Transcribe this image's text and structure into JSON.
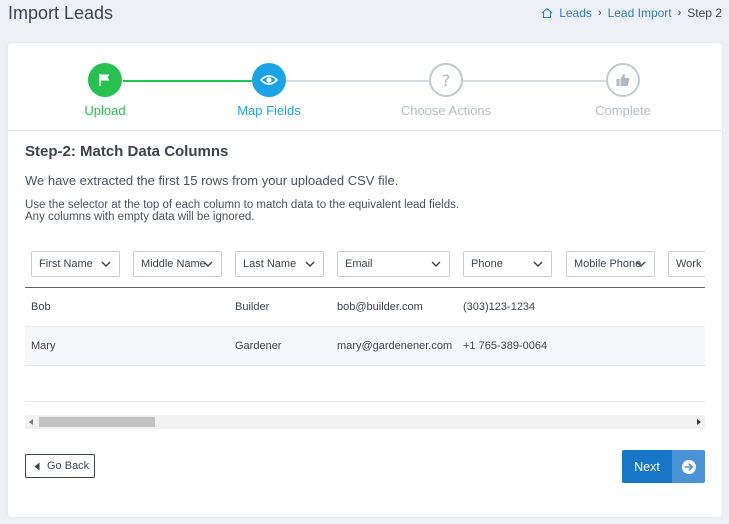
{
  "header": {
    "title": "Import Leads",
    "breadcrumb": {
      "home": "Leads",
      "parent": "Lead Import",
      "current": "Step 2"
    }
  },
  "steps": [
    {
      "label": "Upload",
      "icon": "flag-icon",
      "state": "done",
      "color": "#27c152"
    },
    {
      "label": "Map Fields",
      "icon": "eye-icon",
      "state": "active",
      "color": "#1aa3e6"
    },
    {
      "label": "Choose Actions",
      "icon": "question-icon",
      "state": "pending",
      "color": "#c3c7cf"
    },
    {
      "label": "Complete",
      "icon": "thumbs-up-icon",
      "state": "pending",
      "color": "#c3c7cf"
    }
  ],
  "content": {
    "heading": "Step-2: Match Data Columns",
    "intro": "We have extracted the first 15 rows from your uploaded CSV file.",
    "help_line1": "Use the selector at the top of each column to match data to the equivalent lead fields.",
    "help_line2": "Any columns with empty data will be ignored."
  },
  "columns": [
    "First Name",
    "Middle Name",
    "Last Name",
    "Email",
    "Phone",
    "Mobile Phone",
    "Work Phone"
  ],
  "rows": [
    {
      "first": "Bob",
      "middle": "",
      "last": "Builder",
      "email": "bob@builder.com",
      "phone": "(303)123-1234"
    },
    {
      "first": "Mary",
      "middle": "",
      "last": "Gardener",
      "email": "mary@gardenener.com",
      "phone": "+1 765-389-0064"
    }
  ],
  "buttons": {
    "back": "Go Back",
    "next": "Next"
  }
}
